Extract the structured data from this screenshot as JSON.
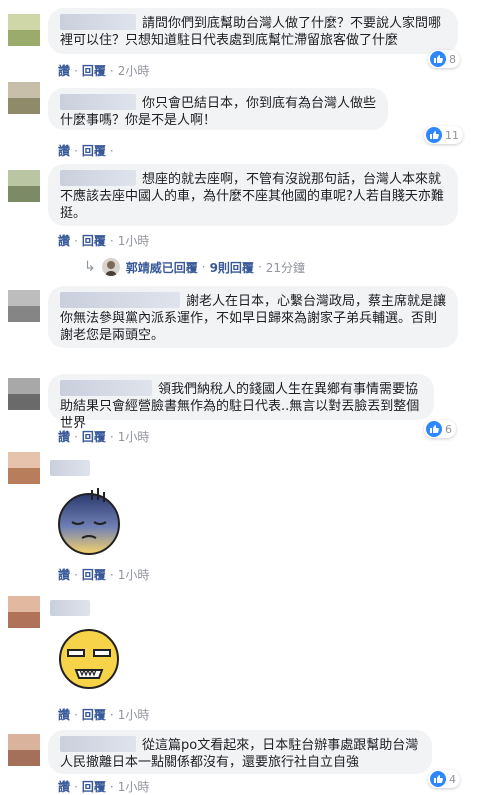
{
  "labels": {
    "like": "讚",
    "reply": "回覆",
    "dot": "·"
  },
  "comments": [
    {
      "text": "請問你們到底幫助台灣人做了什麼？不要說人家問哪裡可以住？只想知道駐日代表處到底幫忙滯留旅客做了什麼",
      "time": "2小時",
      "likes": "8"
    },
    {
      "text": "你只會巴結日本，你到底有為台灣人做些什麼事嗎？你是不是人啊！",
      "time": "",
      "likes": "11"
    },
    {
      "text": "想座的就去座啊，不管有沒說那句話，台灣人本來就不應該去座中國人的車，為什麼不座其他國的車呢?人若自賤天亦難挺。",
      "time": "1小時",
      "likes": ""
    },
    {
      "text": "謝老人在日本，心繫台灣政局，蔡主席就是讓你無法參與黨內派系運作，不如早日歸來為謝家子弟兵輔選。否則謝老您是兩頭空。",
      "time": "",
      "likes": ""
    },
    {
      "text": "領我們納稅人的錢國人生在異鄉有事情需要協助結果只會經營臉書無作為的駐日代表..無言以對丟臉丟到整個世界",
      "time": "1小時",
      "likes": "6"
    },
    {
      "text": "",
      "time": "1小時",
      "likes": ""
    },
    {
      "text": "",
      "time": "1小時",
      "likes": ""
    },
    {
      "text": "從這篇po文看起來，日本駐台辦事處跟幫助台灣人民撤離日本一點關係都沒有，還要旅行社自立自強",
      "time": "1小時",
      "likes": "4"
    }
  ],
  "reply_summary": {
    "name": "郭靖威已回覆",
    "count": "9則回覆",
    "time": "21分鐘"
  },
  "colors": {
    "bubble": "#f2f3f5",
    "link": "#385898",
    "like_blue": "#2d88ff",
    "meta": "#90949c"
  }
}
